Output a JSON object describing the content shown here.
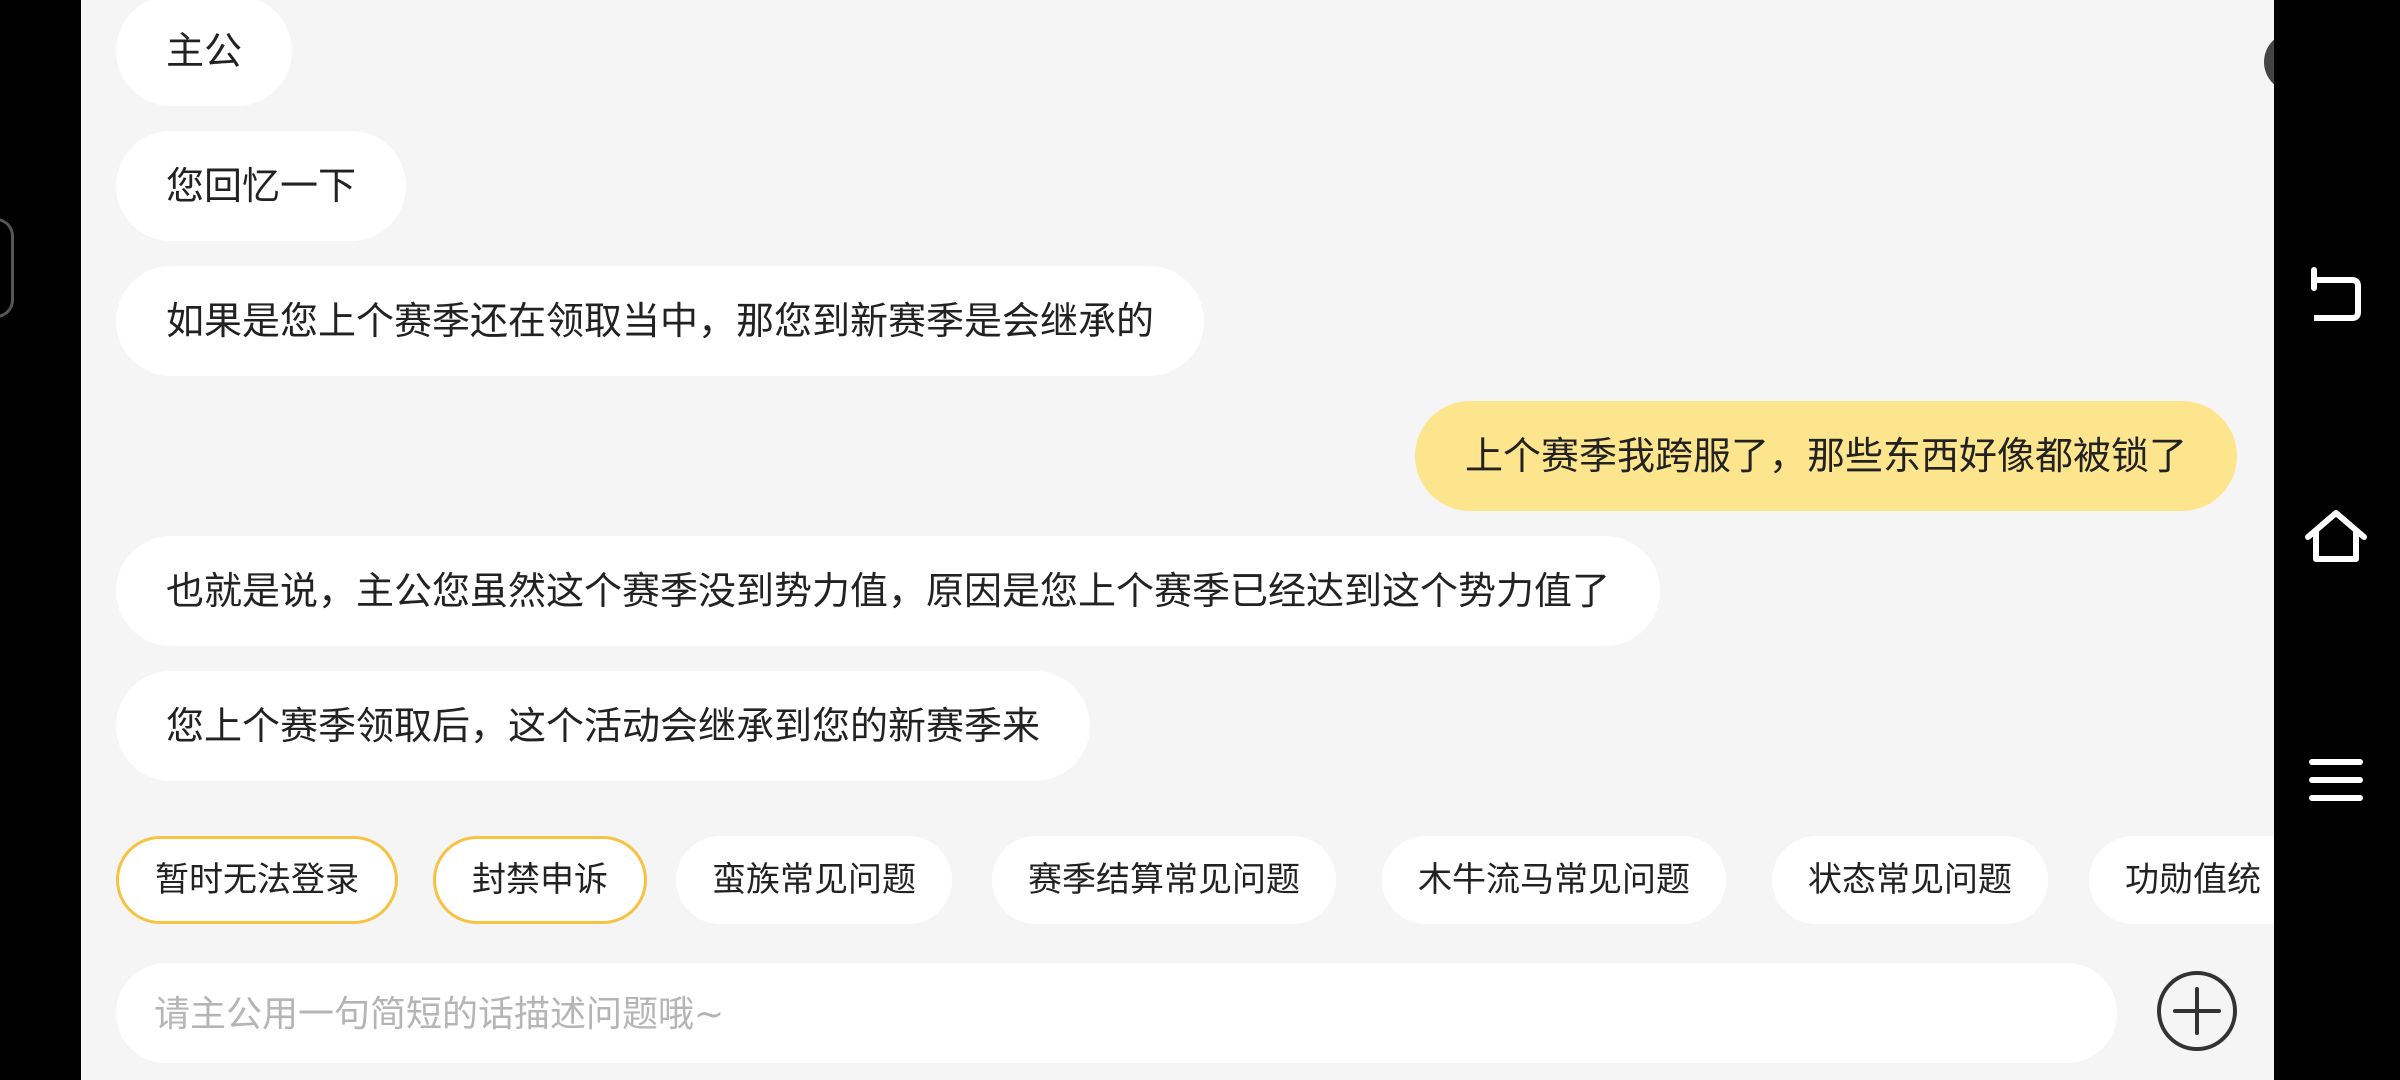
{
  "close_label": "x",
  "messages": [
    {
      "role": "agent",
      "text": "主公"
    },
    {
      "role": "agent",
      "text": "您回忆一下"
    },
    {
      "role": "agent",
      "text": "如果是您上个赛季还在领取当中，那您到新赛季是会继承的"
    },
    {
      "role": "user",
      "text": "上个赛季我跨服了，那些东西好像都被锁了"
    },
    {
      "role": "agent",
      "text": "也就是说，主公您虽然这个赛季没到势力值，原因是您上个赛季已经达到这个势力值了"
    },
    {
      "role": "agent",
      "text": "您上个赛季领取后，这个活动会继承到您的新赛季来"
    }
  ],
  "quick_topics": [
    {
      "label": "暂时无法登录",
      "highlighted": true
    },
    {
      "label": "封禁申诉",
      "highlighted": true
    },
    {
      "label": "蛮族常见问题",
      "highlighted": false
    },
    {
      "label": "赛季结算常见问题",
      "highlighted": false
    },
    {
      "label": "木牛流马常见问题",
      "highlighted": false
    },
    {
      "label": "状态常见问题",
      "highlighted": false
    },
    {
      "label": "功勋值统",
      "highlighted": false
    }
  ],
  "input": {
    "value": "",
    "placeholder": "请主公用一句简短的话描述问题哦~"
  },
  "icons": {
    "close": "close-icon",
    "add": "plus-circle-icon",
    "back": "back-icon",
    "home": "home-icon",
    "menu": "menu-icon"
  },
  "colors": {
    "panel_bg": "#f5f5f5",
    "user_bubble": "#fde58e",
    "agent_bubble": "#ffffff",
    "chip_highlight_border": "#f5c242",
    "placeholder": "#b5b5b5"
  }
}
